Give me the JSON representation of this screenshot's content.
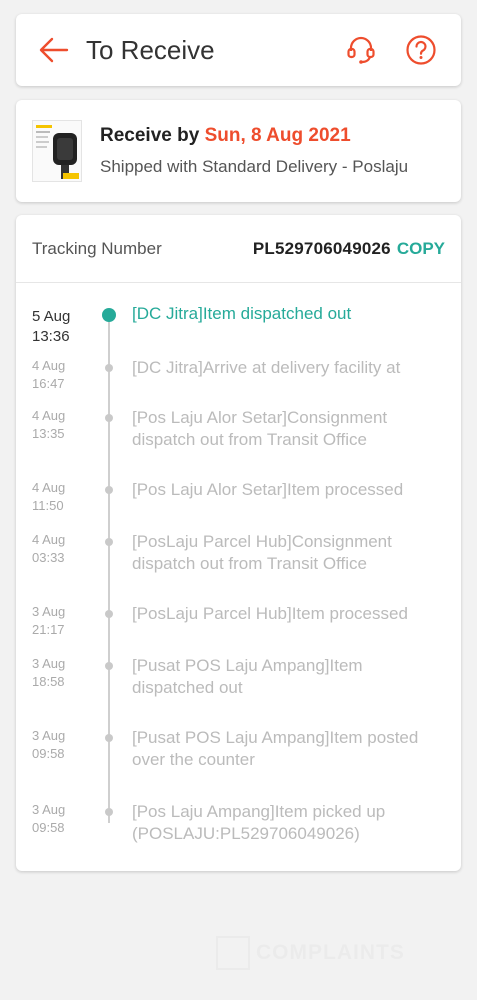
{
  "header": {
    "title": "To Receive",
    "back_icon": "arrow-left-icon",
    "support_icon": "headset-icon",
    "help_icon": "question-circle-icon",
    "accent_color": "#ee4d2d"
  },
  "receive": {
    "prefix": "Receive by",
    "date": "Sun, 8 Aug 2021",
    "shipping": "Shipped with Standard Delivery",
    "courier": " - Poslaju"
  },
  "tracking": {
    "label": "Tracking Number",
    "number": "PL529706049026",
    "copy_label": "COPY",
    "accent_color": "#26aa99",
    "events": [
      {
        "date": "5 Aug",
        "time": "13:36",
        "desc": "[DC Jitra]Item dispatched out",
        "current": true
      },
      {
        "date": "4 Aug",
        "time": "16:47",
        "desc": "[DC Jitra]Arrive at delivery facility at",
        "current": false
      },
      {
        "date": "4 Aug",
        "time": "13:35",
        "desc": "[Pos Laju Alor Setar]Consignment dispatch out from Transit Office",
        "current": false
      },
      {
        "date": "4 Aug",
        "time": "11:50",
        "desc": "[Pos Laju Alor Setar]Item processed",
        "current": false
      },
      {
        "date": "4 Aug",
        "time": "03:33",
        "desc": "[PosLaju Parcel Hub]Consignment dispatch out from Transit Office",
        "current": false
      },
      {
        "date": "3 Aug",
        "time": "21:17",
        "desc": "[PosLaju Parcel Hub]Item processed",
        "current": false
      },
      {
        "date": "3 Aug",
        "time": "18:58",
        "desc": "[Pusat POS Laju Ampang]Item dispatched out",
        "current": false
      },
      {
        "date": "3 Aug",
        "time": "09:58",
        "desc": "[Pusat POS Laju Ampang]Item posted over the counter",
        "current": false
      },
      {
        "date": "3 Aug",
        "time": "09:58",
        "desc": "[Pos Laju Ampang]Item picked up (POSLAJU:PL529706049026)",
        "current": false
      }
    ]
  },
  "watermark": {
    "text": "COMPLAINTS"
  }
}
